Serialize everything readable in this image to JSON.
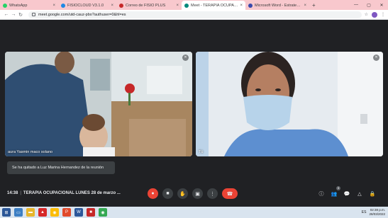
{
  "browser": {
    "tabs": [
      {
        "title": "WhatsApp",
        "color": "#25d366",
        "active": false
      },
      {
        "title": "FISIOCLOUD V3.1.0",
        "color": "#1e88e5",
        "active": false
      },
      {
        "title": "Correo de FISIO PLUS",
        "color": "#c62828",
        "active": false
      },
      {
        "title": "Meet - TERAPIA OCUPACI...",
        "color": "#00897b",
        "active": true
      },
      {
        "title": "Microsoft Word - Estrategias",
        "color": "#3949ab",
        "active": false
      }
    ],
    "new_tab_label": "+",
    "url": "meet.google.com/utd-cauz-pbo?authuser=0&hl=es"
  },
  "meet": {
    "participants": [
      {
        "name": "aura Yasmin maco solano",
        "muted": true
      },
      {
        "name": "Tú",
        "muted": true
      }
    ],
    "toast": "Se ha quitado a Luz Marina Hernandez de la reunión",
    "time": "14:38",
    "meeting_title": "TERAPIA OCUPACIONAL LUNES 28 de marzo ...",
    "participants_count": "3"
  },
  "taskbar": {
    "lang": "ES",
    "time": "02:38 p.m.",
    "date": "28/03/2022"
  }
}
